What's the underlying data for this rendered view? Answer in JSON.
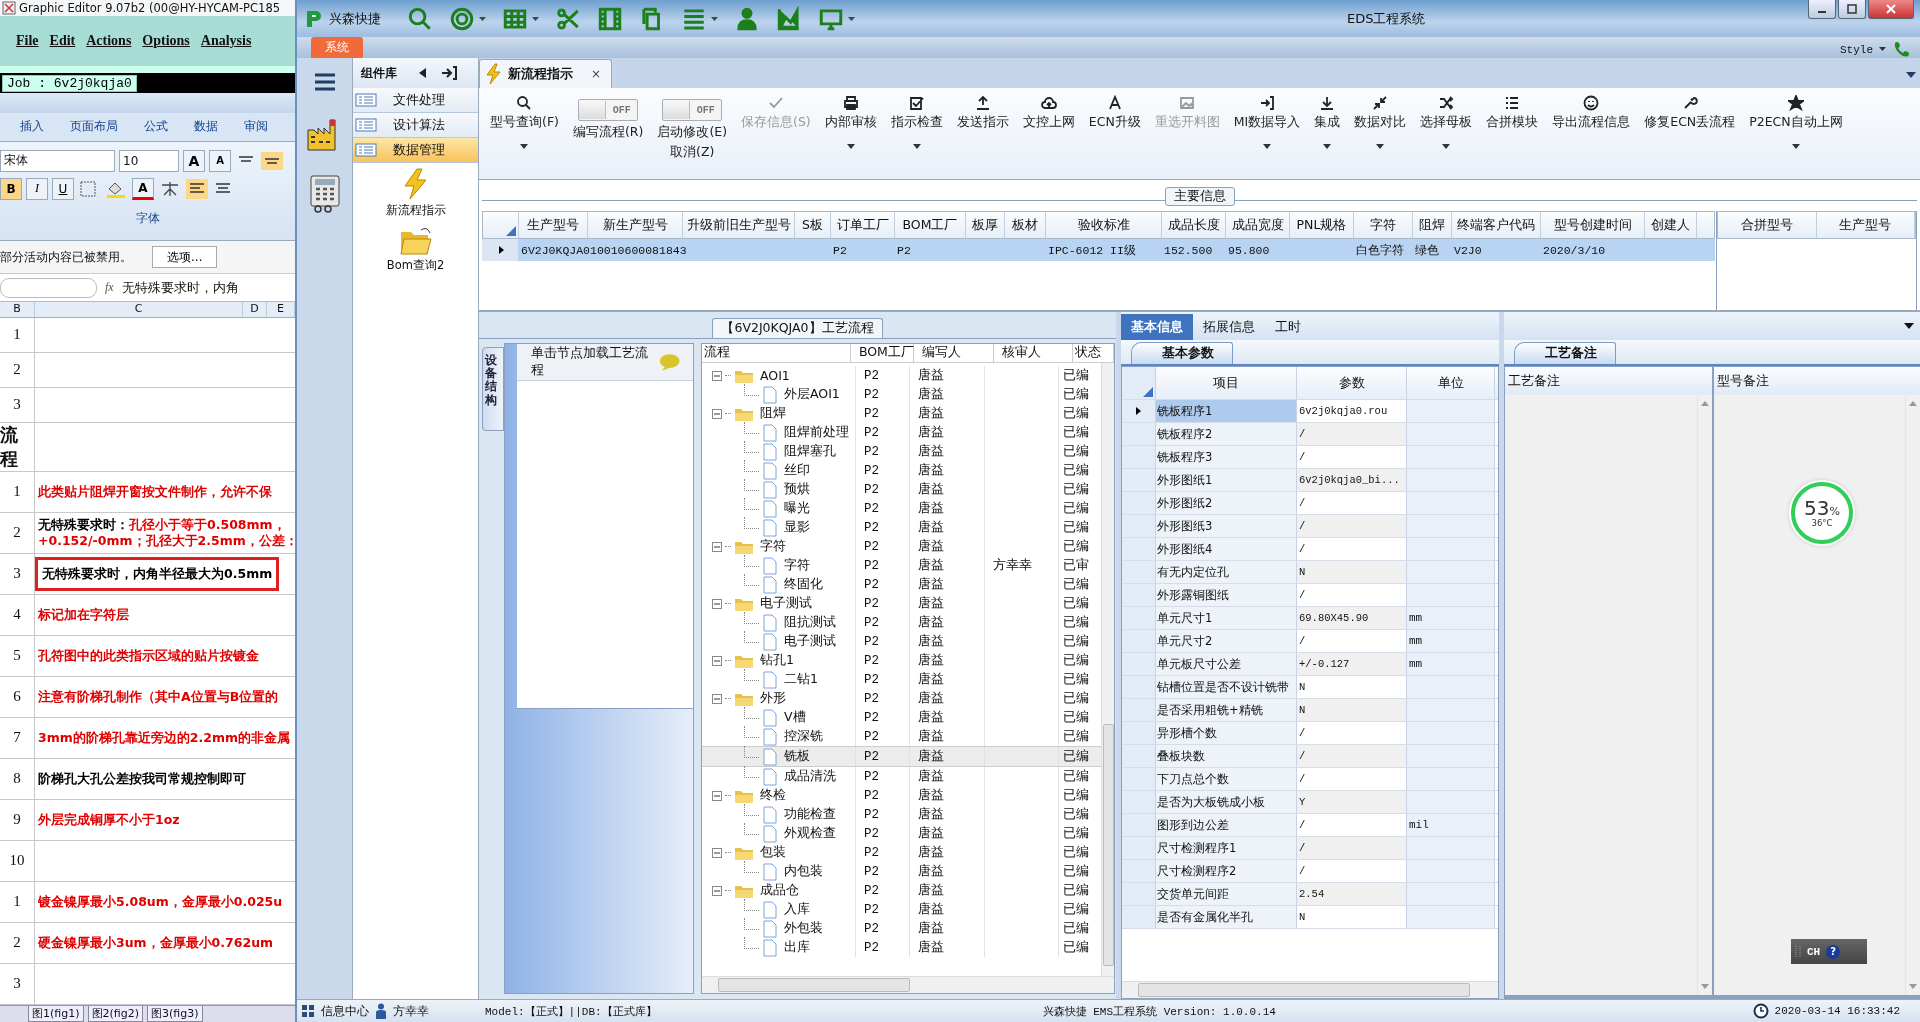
{
  "background_window": {
    "title": "Graphic Editor 9.07b2 (00@HY-HYCAM-PC185",
    "menu": [
      "File",
      "Edit",
      "Actions",
      "Options",
      "Analysis"
    ],
    "job": "Job : 6v2j0kqja0",
    "ribbon_tabs": [
      "插入",
      "页面布局",
      "公式",
      "数据",
      "审阅"
    ],
    "font_name": "宋体",
    "font_size": "10",
    "size_buttons": [
      "A",
      "A"
    ],
    "style_buttons": [
      "B",
      "I",
      "U"
    ],
    "color_button": "A",
    "font_group": "字体",
    "message": "部分活动内容已被禁用。",
    "message_button": "选项...",
    "formula_label": "fx",
    "formula": "无特殊要求时，内角",
    "columns": [
      "B",
      "C",
      "D",
      "E"
    ],
    "rows": [
      {
        "kind": "blank",
        "number": "1"
      },
      {
        "kind": "blank",
        "number": "2"
      },
      {
        "kind": "blank",
        "number": "3"
      },
      {
        "kind": "header",
        "number": "流程"
      },
      {
        "kind": "note",
        "number": "1",
        "text": "此类贴片阻焊开窗按文件制作，允许不保",
        "color": "#e00000",
        "highlighted": false
      },
      {
        "kind": "note",
        "number": "2",
        "lead": "无特殊要求时：",
        "text": "孔径小于等于0.508mm，",
        "text2": "+0.152/-0mm；孔径大于2.5mm，公差：",
        "color": "#e00000",
        "highlighted": false
      },
      {
        "kind": "note",
        "number": "3",
        "text": "无特殊要求时，内角半径最大为0.5mm",
        "color": "#000000",
        "highlighted": true
      },
      {
        "kind": "note",
        "number": "4",
        "text": "标记加在字符层",
        "color": "#e00000",
        "highlighted": false
      },
      {
        "kind": "note",
        "number": "5",
        "text": "孔符图中的此类指示区域的贴片按镀金",
        "color": "#e00000",
        "highlighted": false
      },
      {
        "kind": "note",
        "number": "6",
        "text": "注意有阶梯孔制作（其中A位置与B位置的",
        "color": "#e00000",
        "highlighted": false
      },
      {
        "kind": "note",
        "number": "7",
        "text": "3mm的阶梯孔靠近旁边的2.2mm的非金属",
        "color": "#e00000",
        "highlighted": false
      },
      {
        "kind": "note",
        "number": "8",
        "text": "阶梯孔大孔公差按我司常规控制即可",
        "color": "#000000",
        "highlighted": false
      },
      {
        "kind": "note",
        "number": "9",
        "text": "外层完成铜厚不小于1oz",
        "color": "#e00000",
        "highlighted": false
      },
      {
        "kind": "blank",
        "number": "10"
      },
      {
        "kind": "note",
        "number": "1",
        "text": "镀金镍厚最小5.08um，金厚最小0.025u",
        "color": "#e00000",
        "highlighted": false
      },
      {
        "kind": "note",
        "number": "2",
        "text": "硬金镍厚最小3um，金厚最小0.762um",
        "color": "#e00000",
        "highlighted": false
      },
      {
        "kind": "blank",
        "number": "3"
      }
    ],
    "sheet_tabs": [
      "图1(fig1)",
      "图2(fig2)",
      "图3(fig3)"
    ]
  },
  "window": {
    "app_name": "兴森快捷",
    "title": "EDS工程系统",
    "menu_tab": "系统",
    "style_menu": "Style"
  },
  "library": {
    "title": "组件库",
    "items": [
      {
        "label": "文件处理",
        "selected": false
      },
      {
        "label": "设计算法",
        "selected": false
      },
      {
        "label": "数据管理",
        "selected": true
      }
    ],
    "tools": [
      "新流程指示",
      "Bom查询2"
    ]
  },
  "tab": {
    "label": "新流程指示",
    "close": "×"
  },
  "ribbon": [
    {
      "kind": "button",
      "label": "型号查询(F)",
      "dropdown": true,
      "disabled": false
    },
    {
      "kind": "toggle",
      "label": "编写流程(R)",
      "state": "OFF",
      "on": false
    },
    {
      "kind": "toggle",
      "label": "启动修改(E)",
      "label2": "取消(Z)",
      "state": "OFF",
      "on": false
    },
    {
      "kind": "button",
      "label": "保存信息(S)",
      "dropdown": false,
      "disabled": true
    },
    {
      "kind": "button",
      "label": "内部审核",
      "dropdown": true,
      "disabled": false
    },
    {
      "kind": "button",
      "label": "指示检查",
      "dropdown": true,
      "disabled": false
    },
    {
      "kind": "button",
      "label": "发送指示",
      "dropdown": false,
      "disabled": false
    },
    {
      "kind": "button",
      "label": "文控上网",
      "dropdown": false,
      "disabled": false
    },
    {
      "kind": "button",
      "label": "ECN升级",
      "dropdown": false,
      "disabled": false
    },
    {
      "kind": "button",
      "label": "重选开料图",
      "dropdown": false,
      "disabled": true
    },
    {
      "kind": "button",
      "label": "MI数据导入",
      "dropdown": true,
      "disabled": false
    },
    {
      "kind": "button",
      "label": "集成",
      "dropdown": true,
      "disabled": false
    },
    {
      "kind": "button",
      "label": "数据对比",
      "dropdown": true,
      "disabled": false
    },
    {
      "kind": "button",
      "label": "选择母板",
      "dropdown": true,
      "disabled": false
    },
    {
      "kind": "button",
      "label": "合拼模块",
      "dropdown": false,
      "disabled": false
    },
    {
      "kind": "button",
      "label": "导出流程信息",
      "dropdown": false,
      "disabled": false
    },
    {
      "kind": "button",
      "label": "修复ECN丢流程",
      "dropdown": false,
      "disabled": false
    },
    {
      "kind": "button",
      "label": "P2ECN自动上网",
      "dropdown": true,
      "disabled": false
    }
  ],
  "main_info": {
    "title": "主要信息",
    "columns": [
      "生产型号",
      "新生产型号",
      "升级前旧生产型号",
      "S板",
      "订单工厂",
      "BOM工厂",
      "板厚",
      "板材",
      "验收标准",
      "成品长度",
      "成品宽度",
      "PNL规格",
      "字符",
      "阻焊",
      "终端客户代码",
      "型号创建时间",
      "创建人"
    ],
    "rows": [
      {
        "selected": true,
        "cells": [
          "6V2J0KQJA0",
          "10010600081843",
          "",
          "",
          "P2",
          "P2",
          "",
          "",
          "IPC-6012 II级",
          "152.500",
          "95.800",
          "",
          "白色字符",
          "绿色",
          "V2J0",
          "2020/3/10",
          ""
        ]
      }
    ],
    "merge_columns": [
      "合拼型号",
      "生产型号"
    ]
  },
  "process": {
    "title": "【6V2J0KQJA0】工艺流程",
    "side_tab": "设备结构",
    "hint": "单击节点加载工艺流程",
    "columns": [
      "流程",
      "BOM工厂",
      "编写人",
      "核审人",
      "状态"
    ],
    "nodes": [
      {
        "name": "AOI1",
        "bom": "P2",
        "writer": "唐益",
        "status": "已编",
        "expanded": true,
        "selected": false,
        "children": [
          {
            "name": "外层AOI1",
            "bom": "P2",
            "writer": "唐益",
            "status": "已编",
            "selected": false
          }
        ]
      },
      {
        "name": "阻焊",
        "bom": "P2",
        "writer": "唐益",
        "status": "已编",
        "expanded": true,
        "selected": false,
        "children": [
          {
            "name": "阻焊前处理",
            "bom": "P2",
            "writer": "唐益",
            "status": "已编",
            "selected": false
          },
          {
            "name": "阻焊塞孔",
            "bom": "P2",
            "writer": "唐益",
            "status": "已编",
            "selected": false
          },
          {
            "name": "丝印",
            "bom": "P2",
            "writer": "唐益",
            "status": "已编",
            "selected": false
          },
          {
            "name": "预烘",
            "bom": "P2",
            "writer": "唐益",
            "status": "已编",
            "selected": false
          },
          {
            "name": "曝光",
            "bom": "P2",
            "writer": "唐益",
            "status": "已编",
            "selected": false
          },
          {
            "name": "显影",
            "bom": "P2",
            "writer": "唐益",
            "status": "已编",
            "selected": false
          }
        ]
      },
      {
        "name": "字符",
        "bom": "P2",
        "writer": "唐益",
        "status": "已编",
        "expanded": true,
        "selected": false,
        "children": [
          {
            "name": "字符",
            "bom": "P2",
            "writer": "唐益",
            "reviewer": "方幸幸",
            "status": "已审",
            "selected": false
          },
          {
            "name": "终固化",
            "bom": "P2",
            "writer": "唐益",
            "status": "已编",
            "selected": false
          }
        ]
      },
      {
        "name": "电子测试",
        "bom": "P2",
        "writer": "唐益",
        "status": "已编",
        "expanded": true,
        "selected": false,
        "children": [
          {
            "name": "阻抗测试",
            "bom": "P2",
            "writer": "唐益",
            "status": "已编",
            "selected": false
          },
          {
            "name": "电子测试",
            "bom": "P2",
            "writer": "唐益",
            "status": "已编",
            "selected": false
          }
        ]
      },
      {
        "name": "钻孔1",
        "bom": "P2",
        "writer": "唐益",
        "status": "已编",
        "expanded": true,
        "selected": false,
        "children": [
          {
            "name": "二钻1",
            "bom": "P2",
            "writer": "唐益",
            "status": "已编",
            "selected": false
          }
        ]
      },
      {
        "name": "外形",
        "bom": "P2",
        "writer": "唐益",
        "status": "已编",
        "expanded": true,
        "selected": false,
        "children": [
          {
            "name": "V槽",
            "bom": "P2",
            "writer": "唐益",
            "status": "已编",
            "selected": false
          },
          {
            "name": "控深铣",
            "bom": "P2",
            "writer": "唐益",
            "status": "已编",
            "selected": false
          },
          {
            "name": "铣板",
            "bom": "P2",
            "writer": "唐益",
            "status": "已编",
            "selected": true
          },
          {
            "name": "成品清洗",
            "bom": "P2",
            "writer": "唐益",
            "status": "已编",
            "selected": false
          }
        ]
      },
      {
        "name": "终检",
        "bom": "P2",
        "writer": "唐益",
        "status": "已编",
        "expanded": true,
        "selected": false,
        "children": [
          {
            "name": "功能检查",
            "bom": "P2",
            "writer": "唐益",
            "status": "已编",
            "selected": false
          },
          {
            "name": "外观检查",
            "bom": "P2",
            "writer": "唐益",
            "status": "已编",
            "selected": false
          }
        ]
      },
      {
        "name": "包装",
        "bom": "P2",
        "writer": "唐益",
        "status": "已编",
        "expanded": true,
        "selected": false,
        "children": [
          {
            "name": "内包装",
            "bom": "P2",
            "writer": "唐益",
            "status": "已编",
            "selected": false
          }
        ]
      },
      {
        "name": "成品仓",
        "bom": "P2",
        "writer": "唐益",
        "status": "已编",
        "expanded": true,
        "selected": false,
        "children": [
          {
            "name": "入库",
            "bom": "P2",
            "writer": "唐益",
            "status": "已编",
            "selected": false
          },
          {
            "name": "外包装",
            "bom": "P2",
            "writer": "唐益",
            "status": "已编",
            "selected": false
          },
          {
            "name": "出库",
            "bom": "P2",
            "writer": "唐益",
            "status": "已编",
            "selected": false
          }
        ]
      }
    ]
  },
  "params": {
    "tabs": [
      {
        "label": "基本信息",
        "selected": true
      },
      {
        "label": "拓展信息",
        "selected": false
      },
      {
        "label": "工时",
        "selected": false
      }
    ],
    "subtab": "基本参数",
    "columns": [
      "项目",
      "参数",
      "单位"
    ],
    "rows": [
      {
        "item": "铣板程序1",
        "value": "6v2j0kqja0.rou",
        "selected": true
      },
      {
        "item": "铣板程序2",
        "value": "/",
        "selected": false
      },
      {
        "item": "铣板程序3",
        "value": "/",
        "selected": false
      },
      {
        "item": "外形图纸1",
        "value": "6v2j0kqja0_bi...",
        "selected": false
      },
      {
        "item": "外形图纸2",
        "value": "/",
        "selected": false
      },
      {
        "item": "外形图纸3",
        "value": "/",
        "selected": false
      },
      {
        "item": "外形图纸4",
        "value": "/",
        "selected": false
      },
      {
        "item": "有无内定位孔",
        "value": "N",
        "selected": false
      },
      {
        "item": "外形露铜图纸",
        "value": "/",
        "selected": false
      },
      {
        "item": "单元尺寸1",
        "value": "69.80X45.90",
        "unit": "mm",
        "selected": false
      },
      {
        "item": "单元尺寸2",
        "value": "/",
        "unit": "mm",
        "selected": false
      },
      {
        "item": "单元板尺寸公差",
        "value": "+/-0.127",
        "unit": "mm",
        "selected": false
      },
      {
        "item": "钻槽位置是否不设计铣带",
        "value": "N",
        "selected": false
      },
      {
        "item": "是否采用粗铣+精铣",
        "value": "N",
        "selected": false
      },
      {
        "item": "异形槽个数",
        "value": "/",
        "selected": false
      },
      {
        "item": "叠板块数",
        "value": "/",
        "selected": false
      },
      {
        "item": "下刀点总个数",
        "value": "/",
        "selected": false
      },
      {
        "item": "是否为大板铣成小板",
        "value": "Y",
        "selected": false
      },
      {
        "item": "图形到边公差",
        "value": "/",
        "unit": "mil",
        "selected": false
      },
      {
        "item": "尺寸检测程序1",
        "value": "/",
        "selected": false
      },
      {
        "item": "尺寸检测程序2",
        "value": "/",
        "selected": false
      },
      {
        "item": "交货单元间距",
        "value": "2.54",
        "selected": false
      },
      {
        "item": "是否有金属化半孔",
        "value": "N",
        "selected": false
      }
    ]
  },
  "notes": {
    "subtab": "工艺备注",
    "columns": [
      "工艺备注",
      "型号备注"
    ]
  },
  "gauge": {
    "percent": "53",
    "unit": "%",
    "temperature": "36°C"
  },
  "language_bar": {
    "label": "CH",
    "help": "?"
  },
  "status_bar": {
    "info": "信息中心",
    "user": "方幸幸",
    "mode": "Model:【正式】||DB:【正式库】",
    "app": "兴森快捷  EMS工程系统  Version: 1.0.0.14",
    "time": "2020-03-14 16:33:42"
  }
}
